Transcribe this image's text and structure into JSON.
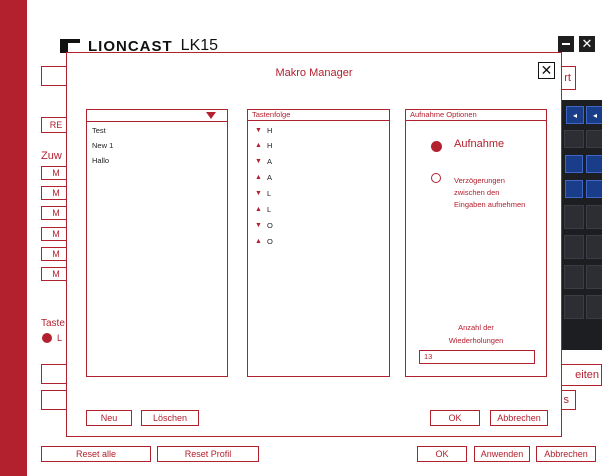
{
  "app": {
    "brand": "LIONCAST",
    "model": "LK15",
    "minimize_icon": "minimize-icon",
    "close_icon": "close-icon"
  },
  "background": {
    "button_record_partial": "RE",
    "section_partial": "Zuw",
    "macro_slots": [
      "M",
      "M",
      "M",
      "M",
      "M",
      "M"
    ],
    "section2_partial": "Taste",
    "radio_partial": "L",
    "right_button1_partial": "rt",
    "right_button2_partial": "eiten",
    "right_button3_partial": "s"
  },
  "bottom_bar": {
    "reset_all": "Reset alle",
    "reset_profile": "Reset Profil",
    "ok": "OK",
    "apply": "Anwenden",
    "cancel": "Abbrechen"
  },
  "dialog": {
    "title": "Makro Manager",
    "macro_list": {
      "items": [
        "Test",
        "New 1",
        "Hallo"
      ]
    },
    "sequence": {
      "header": "Tastenfolge",
      "items": [
        {
          "dir": "down",
          "key": "H"
        },
        {
          "dir": "up",
          "key": "H"
        },
        {
          "dir": "down",
          "key": "A"
        },
        {
          "dir": "up",
          "key": "A"
        },
        {
          "dir": "down",
          "key": "L"
        },
        {
          "dir": "up",
          "key": "L"
        },
        {
          "dir": "down",
          "key": "O"
        },
        {
          "dir": "up",
          "key": "O"
        }
      ]
    },
    "options": {
      "header": "Aufnahme Optionen",
      "record_label": "Aufnahme",
      "delay_label_1": "Verzögerungen",
      "delay_label_2": "zwischen den",
      "delay_label_3": "Eingaben aufnehmen",
      "repeat_label_1": "Anzahl der",
      "repeat_label_2": "Wiederholungen",
      "repeat_value": "13"
    },
    "buttons": {
      "new": "Neu",
      "delete": "Löschen",
      "ok": "OK",
      "cancel": "Abbrechen"
    }
  },
  "colors": {
    "accent": "#b3202e",
    "keyboard": "#1d1e22",
    "key_blue": "#1a3d8a"
  }
}
